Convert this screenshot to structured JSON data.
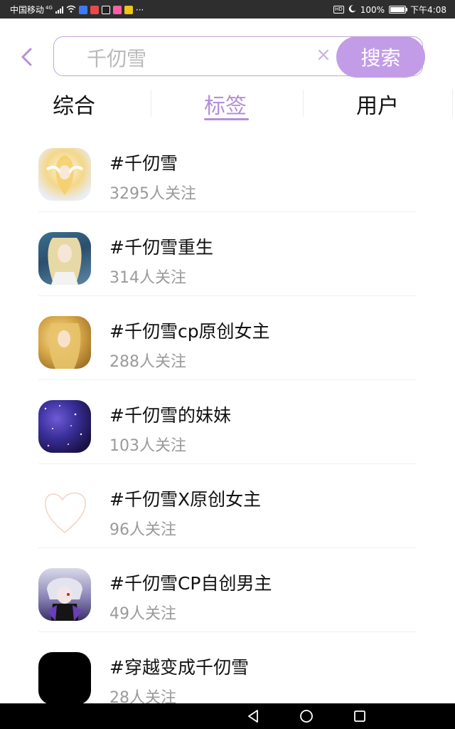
{
  "status_bar": {
    "carrier": "中国移动",
    "network_badge": "4G",
    "ellipsis": "···",
    "hd_badge": "HD",
    "battery_percent": "100%",
    "time": "下午4:08",
    "battery_level": 1.0
  },
  "header": {
    "back_icon": "chevron-left-icon",
    "search_value": "千仞雪",
    "search_button_label": "搜索",
    "accent_color": "#c39ce8"
  },
  "tabs": [
    {
      "label": "综合",
      "active": false
    },
    {
      "label": "标签",
      "active": true
    },
    {
      "label": "用户",
      "active": false
    }
  ],
  "tags": [
    {
      "title": "#千仞雪",
      "followers": "3295人关注"
    },
    {
      "title": "#千仞雪重生",
      "followers": "314人关注"
    },
    {
      "title": "#千仞雪cp原创女主",
      "followers": "288人关注"
    },
    {
      "title": "#千仞雪的妹妹",
      "followers": "103人关注"
    },
    {
      "title": "#千仞雪X原创女主",
      "followers": "96人关注"
    },
    {
      "title": "#千仞雪CP自创男主",
      "followers": "49人关注"
    },
    {
      "title": "#穿越变成千仞雪",
      "followers": "28人关注"
    }
  ],
  "nav_bar": {
    "back": "triangle-back-icon",
    "home": "circle-home-icon",
    "recents": "square-recents-icon"
  }
}
